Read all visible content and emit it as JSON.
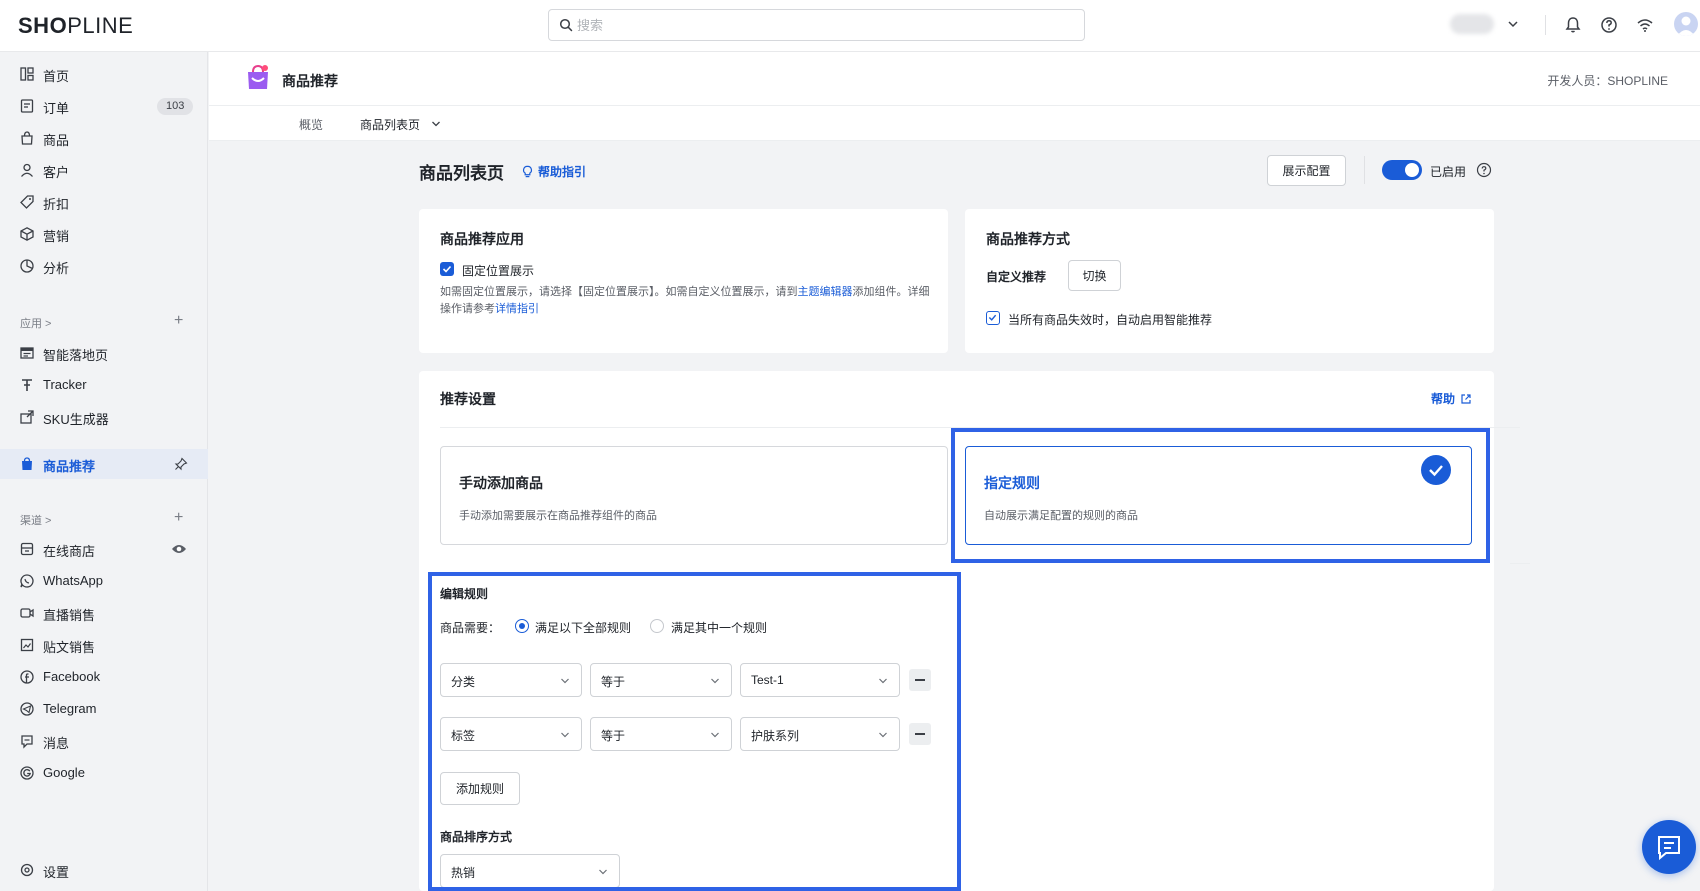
{
  "topbar": {
    "logo_bold": "SH",
    "logo_o": "O",
    "logo_rest": "PLINE",
    "search_placeholder": "搜索"
  },
  "sidebar": {
    "items": [
      {
        "label": "首页",
        "icon": "home-icon"
      },
      {
        "label": "订单",
        "icon": "order-icon",
        "badge": "103"
      },
      {
        "label": "商品",
        "icon": "product-bag-icon"
      },
      {
        "label": "客户",
        "icon": "customer-icon"
      },
      {
        "label": "折扣",
        "icon": "discount-tag-icon"
      },
      {
        "label": "营销",
        "icon": "marketing-cube-icon"
      },
      {
        "label": "分析",
        "icon": "analytics-icon"
      }
    ],
    "apps_section": "应用 >",
    "apps": [
      {
        "label": "智能落地页",
        "icon": "landing-page-icon"
      },
      {
        "label": "Tracker",
        "icon": "tracker-icon"
      },
      {
        "label": "SKU生成器",
        "icon": "sku-generator-icon"
      },
      {
        "label": "商品推荐",
        "icon": "product-recommend-icon",
        "active": true
      }
    ],
    "channels_section": "渠道 >",
    "channels": [
      {
        "label": "在线商店",
        "icon": "online-store-icon"
      },
      {
        "label": "WhatsApp",
        "icon": "whatsapp-icon"
      },
      {
        "label": "直播销售",
        "icon": "live-sales-icon"
      },
      {
        "label": "贴文销售",
        "icon": "post-sales-icon"
      },
      {
        "label": "Facebook",
        "icon": "facebook-icon"
      },
      {
        "label": "Telegram",
        "icon": "telegram-icon"
      },
      {
        "label": "消息",
        "icon": "message-icon"
      },
      {
        "label": "Google",
        "icon": "google-icon"
      }
    ],
    "settings": "设置"
  },
  "app_header": {
    "title": "商品推荐",
    "developer": "开发人员：SHOPLINE",
    "tabs": [
      "概览",
      "商品列表页"
    ]
  },
  "page": {
    "title": "商品列表页",
    "help_guide": "帮助指引",
    "display_config": "展示配置",
    "enabled_label": "已启用"
  },
  "app_card": {
    "title": "商品推荐应用",
    "checkbox_label": "固定位置展示",
    "desc_part1": "如需固定位置展示，请选择【固定位置展示】。如需自定义位置展示，请到",
    "desc_link1": "主题编辑器",
    "desc_part2": "添加组件。详细",
    "desc_part3": "操作请参考",
    "desc_link2": "详情指引"
  },
  "method_card": {
    "title": "商品推荐方式",
    "label": "自定义推荐",
    "switch_button": "切换",
    "checkbox_label": "当所有商品失效时，自动启用智能推荐"
  },
  "settings_card": {
    "title": "推荐设置",
    "help": "帮助",
    "manual": {
      "title": "手动添加商品",
      "desc": "手动添加需要展示在商品推荐组件的商品"
    },
    "rule": {
      "title": "指定规则",
      "desc": "自动展示满足配置的规则的商品"
    },
    "edit_rules": "编辑规则",
    "condition_label": "商品需要：",
    "radio_all": "满足以下全部规则",
    "radio_any": "满足其中一个规则",
    "rules": [
      {
        "field": "分类",
        "op": "等于",
        "value": "Test-1"
      },
      {
        "field": "标签",
        "op": "等于",
        "value": "护肤系列"
      }
    ],
    "add_rule": "添加规则",
    "sort_label": "商品排序方式",
    "sort_value": "热销"
  },
  "colors": {
    "accent": "#1a5cd7",
    "highlight": "#2f62e6"
  }
}
